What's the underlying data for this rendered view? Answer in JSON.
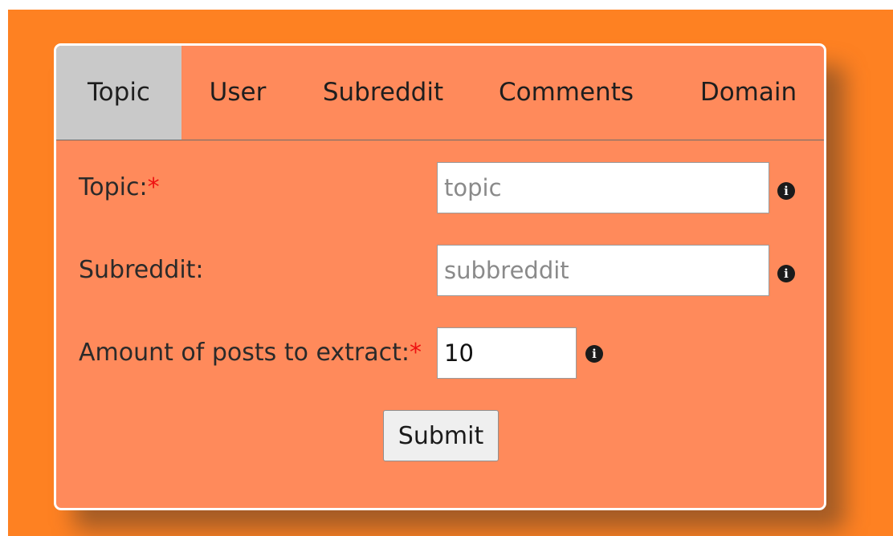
{
  "tabs": [
    {
      "label": "Topic",
      "active": true
    },
    {
      "label": "User",
      "active": false
    },
    {
      "label": "Subreddit",
      "active": false
    },
    {
      "label": "Comments",
      "active": false
    },
    {
      "label": "Domain",
      "active": false
    }
  ],
  "form": {
    "topic": {
      "label": "Topic:",
      "required_marker": "*",
      "value": "",
      "placeholder": "topic",
      "info_icon": "info-circle-icon"
    },
    "subreddit": {
      "label": "Subreddit:",
      "value": "",
      "placeholder": "subbreddit",
      "info_icon": "info-circle-icon"
    },
    "amount": {
      "label": "Amount of posts to extract:",
      "required_marker": "*",
      "value": "10",
      "info_icon": "info-circle-icon"
    },
    "submit_label": "Submit"
  },
  "colors": {
    "background": "#fe8122",
    "panel": "#ff8a5b",
    "active_tab": "#c9c9c9",
    "required_marker": "#ee1111"
  }
}
